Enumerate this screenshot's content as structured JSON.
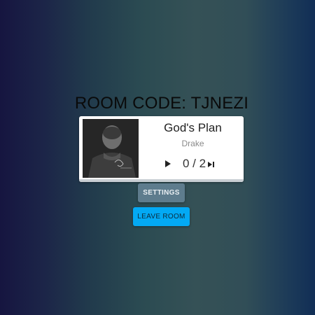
{
  "room": {
    "code_label": "ROOM CODE: TJNEZI"
  },
  "player": {
    "title": "God's Plan",
    "artist": "Drake",
    "votes": "0 / 2",
    "progress_fraction": 0,
    "play_icon": "play-icon",
    "skip_icon": "skip-next-icon"
  },
  "buttons": {
    "settings_label": "SETTINGS",
    "leave_label": "LEAVE ROOM"
  },
  "colors": {
    "leave_button": "#03a9f4",
    "settings_button": "#5e7c8d"
  }
}
